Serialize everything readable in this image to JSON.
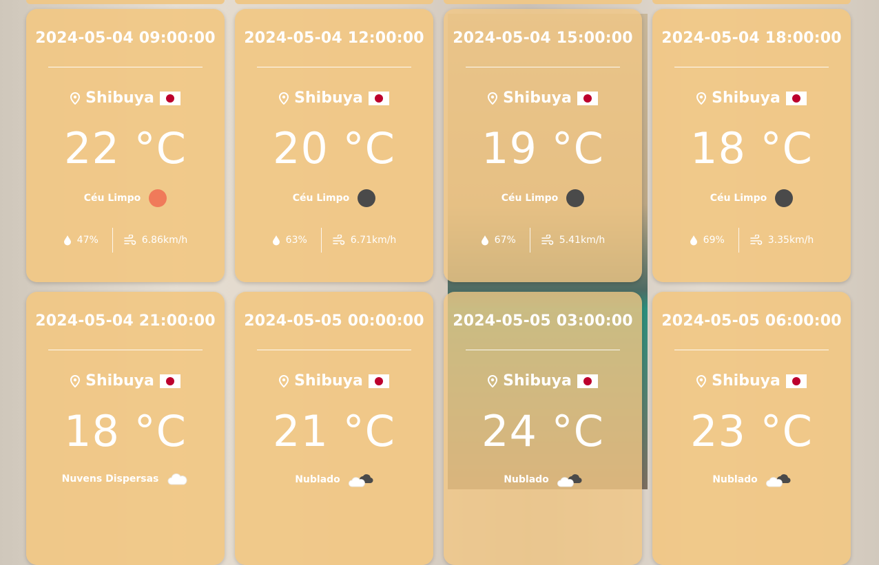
{
  "cards": [
    {
      "datetime": "2024-05-04 09:00:00",
      "location": "Shibuya",
      "temp": "22 °C",
      "condition": "Céu Limpo",
      "cond_icon": "sun-dot-icon",
      "cond_color": "#f07a5a",
      "humidity": "47%",
      "wind": "6.86km/h"
    },
    {
      "datetime": "2024-05-04 12:00:00",
      "location": "Shibuya",
      "temp": "20 °C",
      "condition": "Céu Limpo",
      "cond_icon": "moon-dot-icon",
      "cond_color": "#4a4a4a",
      "humidity": "63%",
      "wind": "6.71km/h"
    },
    {
      "datetime": "2024-05-04 15:00:00",
      "location": "Shibuya",
      "temp": "19 °C",
      "condition": "Céu Limpo",
      "cond_icon": "moon-dot-icon",
      "cond_color": "#4a4a4a",
      "humidity": "67%",
      "wind": "5.41km/h"
    },
    {
      "datetime": "2024-05-04 18:00:00",
      "location": "Shibuya",
      "temp": "18 °C",
      "condition": "Céu Limpo",
      "cond_icon": "moon-dot-icon",
      "cond_color": "#4a4a4a",
      "humidity": "69%",
      "wind": "3.35km/h"
    },
    {
      "datetime": "2024-05-04 21:00:00",
      "location": "Shibuya",
      "temp": "18 °C",
      "condition": "Nuvens Dispersas",
      "cond_icon": "cloud-icon"
    },
    {
      "datetime": "2024-05-05 00:00:00",
      "location": "Shibuya",
      "temp": "21 °C",
      "condition": "Nublado",
      "cond_icon": "dark-clouds-icon"
    },
    {
      "datetime": "2024-05-05 03:00:00",
      "location": "Shibuya",
      "temp": "24 °C",
      "condition": "Nublado",
      "cond_icon": "dark-clouds-icon"
    },
    {
      "datetime": "2024-05-05 06:00:00",
      "location": "Shibuya",
      "temp": "23 °C",
      "condition": "Nublado",
      "cond_icon": "dark-clouds-icon"
    }
  ]
}
